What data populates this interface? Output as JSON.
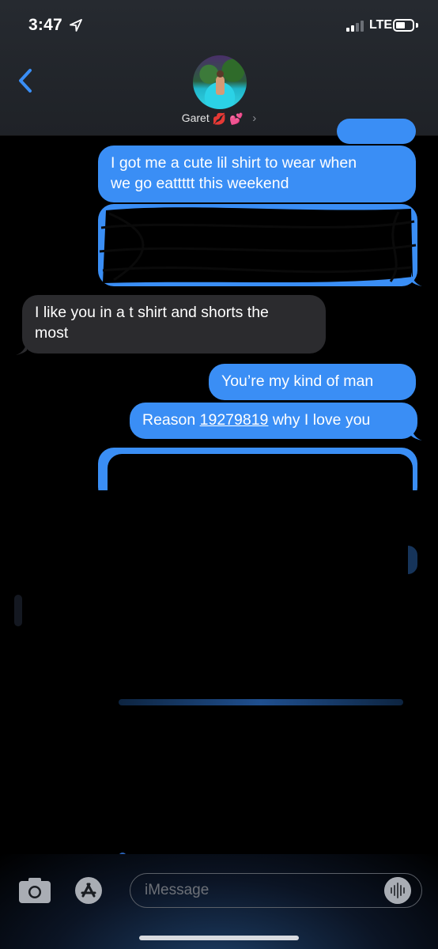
{
  "status_bar": {
    "time": "3:47",
    "network": "LTE"
  },
  "header": {
    "contact_name": "Garet",
    "contact_emoji_1": "💋",
    "contact_emoji_2": "💕",
    "chevron": "›"
  },
  "messages": [
    {
      "id": "m1",
      "side": "sent",
      "lines": [
        "I got me a cute lil shirt to wear when",
        "we go eattttt this weekend"
      ]
    },
    {
      "id": "m2",
      "side": "sent",
      "redacted": true
    },
    {
      "id": "m3",
      "side": "received",
      "lines": [
        "I like you in a t shirt and shorts the",
        "most"
      ]
    },
    {
      "id": "m4",
      "side": "sent",
      "text": "You’re my kind of man"
    },
    {
      "id": "m5",
      "side": "sent",
      "prefix": "Reason ",
      "link": "19279819",
      "suffix": " why I love you"
    }
  ],
  "composer": {
    "placeholder": "iMessage"
  },
  "icons": [
    "location-arrow-icon",
    "back-chevron-icon",
    "camera-icon",
    "app-store-icon",
    "audio-waveform-icon"
  ],
  "colors": {
    "sent_bubble": "#3a8ef5",
    "received_bubble": "#2b2b2e",
    "accent": "#3a8ef5"
  }
}
